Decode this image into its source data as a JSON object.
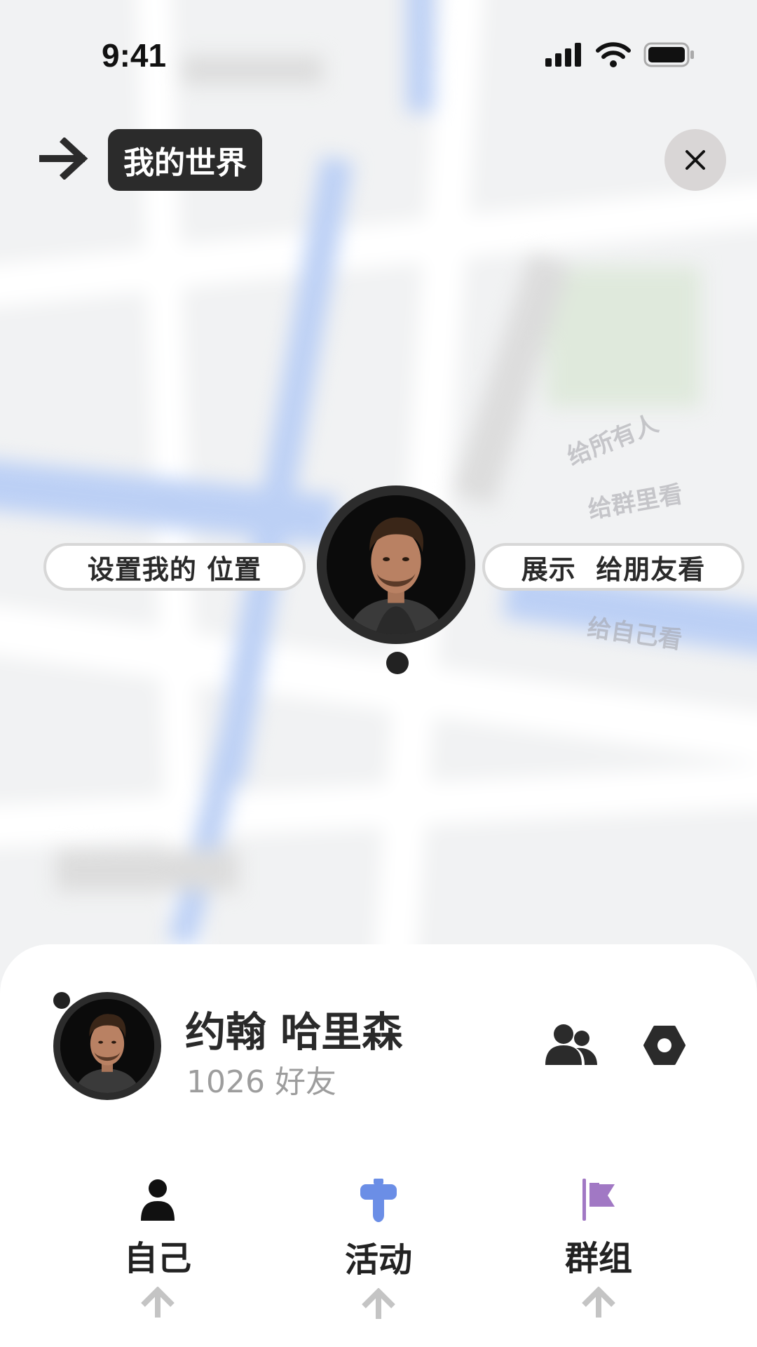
{
  "status_bar": {
    "time": "9:41"
  },
  "header": {
    "title": "我的世界"
  },
  "map": {
    "labels": [
      {
        "text": "给所有人"
      },
      {
        "text": "给群里看"
      },
      {
        "text": "给自己看"
      }
    ]
  },
  "pills": {
    "set_location": "设置我的 位置",
    "show_friends": "展示  给朋友看"
  },
  "profile": {
    "name": "约翰 哈里森",
    "friends": "1026 好友"
  },
  "tabs": [
    {
      "label": "自己",
      "icon": "person-icon",
      "color": "#111111"
    },
    {
      "label": "活动",
      "icon": "pin-icon",
      "color": "#6b8ee6"
    },
    {
      "label": "群组",
      "icon": "flag-icon",
      "color": "#a178c4"
    }
  ],
  "colors": {
    "accent_blue": "#6b8ee6",
    "accent_purple": "#a178c4",
    "dark": "#2b2b2b"
  }
}
